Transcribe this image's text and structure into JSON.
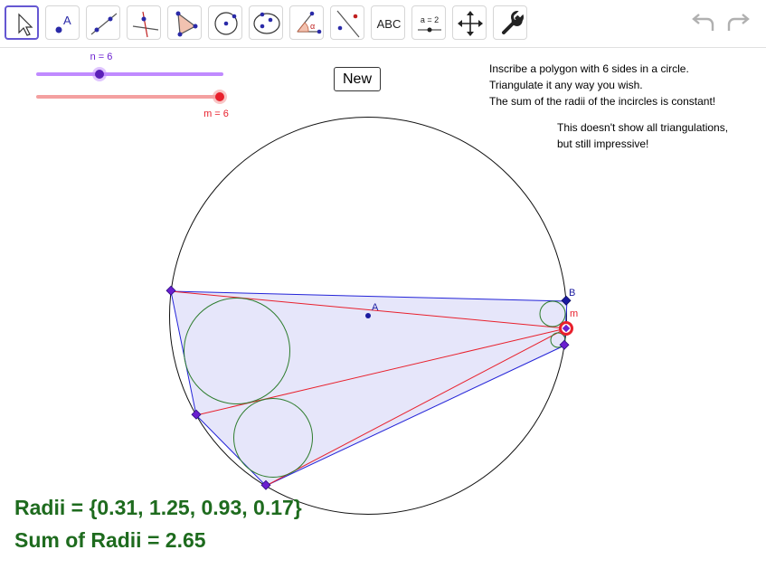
{
  "toolbar": {
    "tools": [
      {
        "name": "move-tool",
        "icon": "arrow-cursor-icon"
      },
      {
        "name": "point-tool",
        "icon": "point-icon",
        "label": "A"
      },
      {
        "name": "line-tool",
        "icon": "line-through-points-icon"
      },
      {
        "name": "perpendicular-tool",
        "icon": "perpendicular-line-icon"
      },
      {
        "name": "polygon-tool",
        "icon": "polygon-icon"
      },
      {
        "name": "circle-tool",
        "icon": "circle-center-point-icon"
      },
      {
        "name": "conic-tool",
        "icon": "ellipse-icon"
      },
      {
        "name": "angle-tool",
        "icon": "angle-icon",
        "label": "α"
      },
      {
        "name": "reflect-tool",
        "icon": "reflect-about-line-icon"
      },
      {
        "name": "text-tool",
        "icon": "text-icon",
        "label": "ABC"
      },
      {
        "name": "slider-tool",
        "icon": "slider-icon",
        "label": "a = 2"
      },
      {
        "name": "move-graphics-tool",
        "icon": "move-graphics-view-icon"
      },
      {
        "name": "settings-tool",
        "icon": "wrench-icon"
      }
    ],
    "undo_icon": "undo-icon",
    "redo_icon": "redo-icon"
  },
  "sliders": {
    "n_label": "n = 6",
    "m_label": "m = 6"
  },
  "new_button_label": "New",
  "instructions": [
    "Inscribe a polygon with 6 sides in a circle.",
    "Triangulate it any way you wish.",
    "The sum of the radii of the incircles is constant!"
  ],
  "note": [
    "This doesn't show all triangulations,",
    "but still impressive!"
  ],
  "points": {
    "center_label": "A",
    "b_label": "B",
    "m_label": "m"
  },
  "results": {
    "radii": "Radii = {0.31, 1.25, 0.93, 0.17}",
    "sum": "Sum of Radii = 2.65"
  },
  "colors": {
    "accent": "#6557d2",
    "polygon_fill": "#e6e6fa",
    "polygon_edge": "#2424d8",
    "diagonal": "#e8202c",
    "incircle": "#2e7d2e",
    "vertex": "#6a1fd0",
    "slider_n": "#c08aff",
    "slider_m": "#f4a0a0",
    "result_text": "#1e6b1e"
  }
}
